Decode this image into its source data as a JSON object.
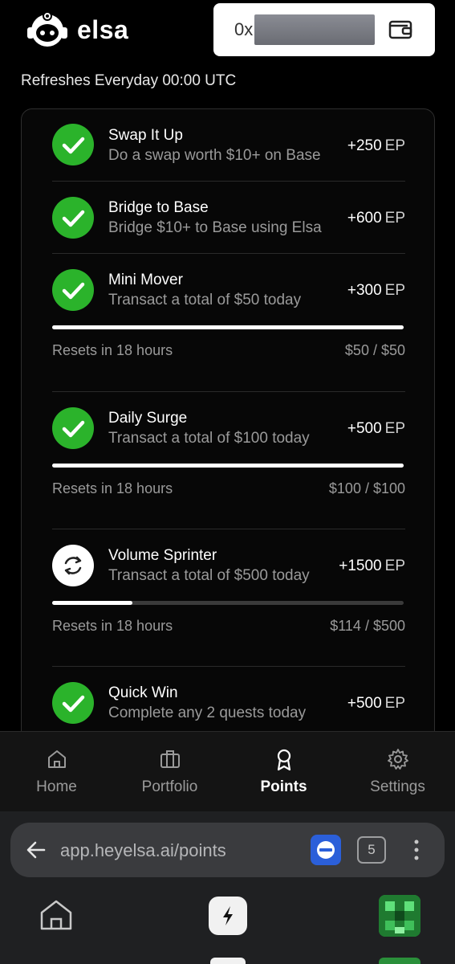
{
  "header": {
    "brand": "elsa",
    "wallet_prefix": "0x"
  },
  "refresh_note": "Refreshes Everyday 00:00 UTC",
  "quests": [
    {
      "title": "Swap It Up",
      "desc": "Do a swap worth $10+ on Base",
      "points": "+250",
      "unit": "EP",
      "status": "done"
    },
    {
      "title": "Bridge to Base",
      "desc": "Bridge $10+ to Base using Elsa",
      "points": "+600",
      "unit": "EP",
      "status": "done"
    },
    {
      "title": "Mini Mover",
      "desc": "Transact a total of $50 today",
      "points": "+300",
      "unit": "EP",
      "status": "done",
      "progress": 1.0,
      "resets": "Resets in 18 hours",
      "amount": "$50 / $50"
    },
    {
      "title": "Daily Surge",
      "desc": "Transact a total of $100 today",
      "points": "+500",
      "unit": "EP",
      "status": "done",
      "progress": 1.0,
      "resets": "Resets in 18 hours",
      "amount": "$100 / $100"
    },
    {
      "title": "Volume Sprinter",
      "desc": "Transact a total of $500 today",
      "points": "+1500",
      "unit": "EP",
      "status": "pending",
      "progress": 0.228,
      "resets": "Resets in 18 hours",
      "amount": "$114 / $500"
    },
    {
      "title": "Quick Win",
      "desc": "Complete any 2 quests today",
      "points": "+500",
      "unit": "EP",
      "status": "done"
    }
  ],
  "nav": {
    "home": "Home",
    "portfolio": "Portfolio",
    "points": "Points",
    "settings": "Settings",
    "active": "points"
  },
  "browser": {
    "url": "app.heyelsa.ai/points",
    "tab_count": "5"
  },
  "colors": {
    "done": "#2bb32b",
    "accent_blue": "#2b5fd9"
  }
}
